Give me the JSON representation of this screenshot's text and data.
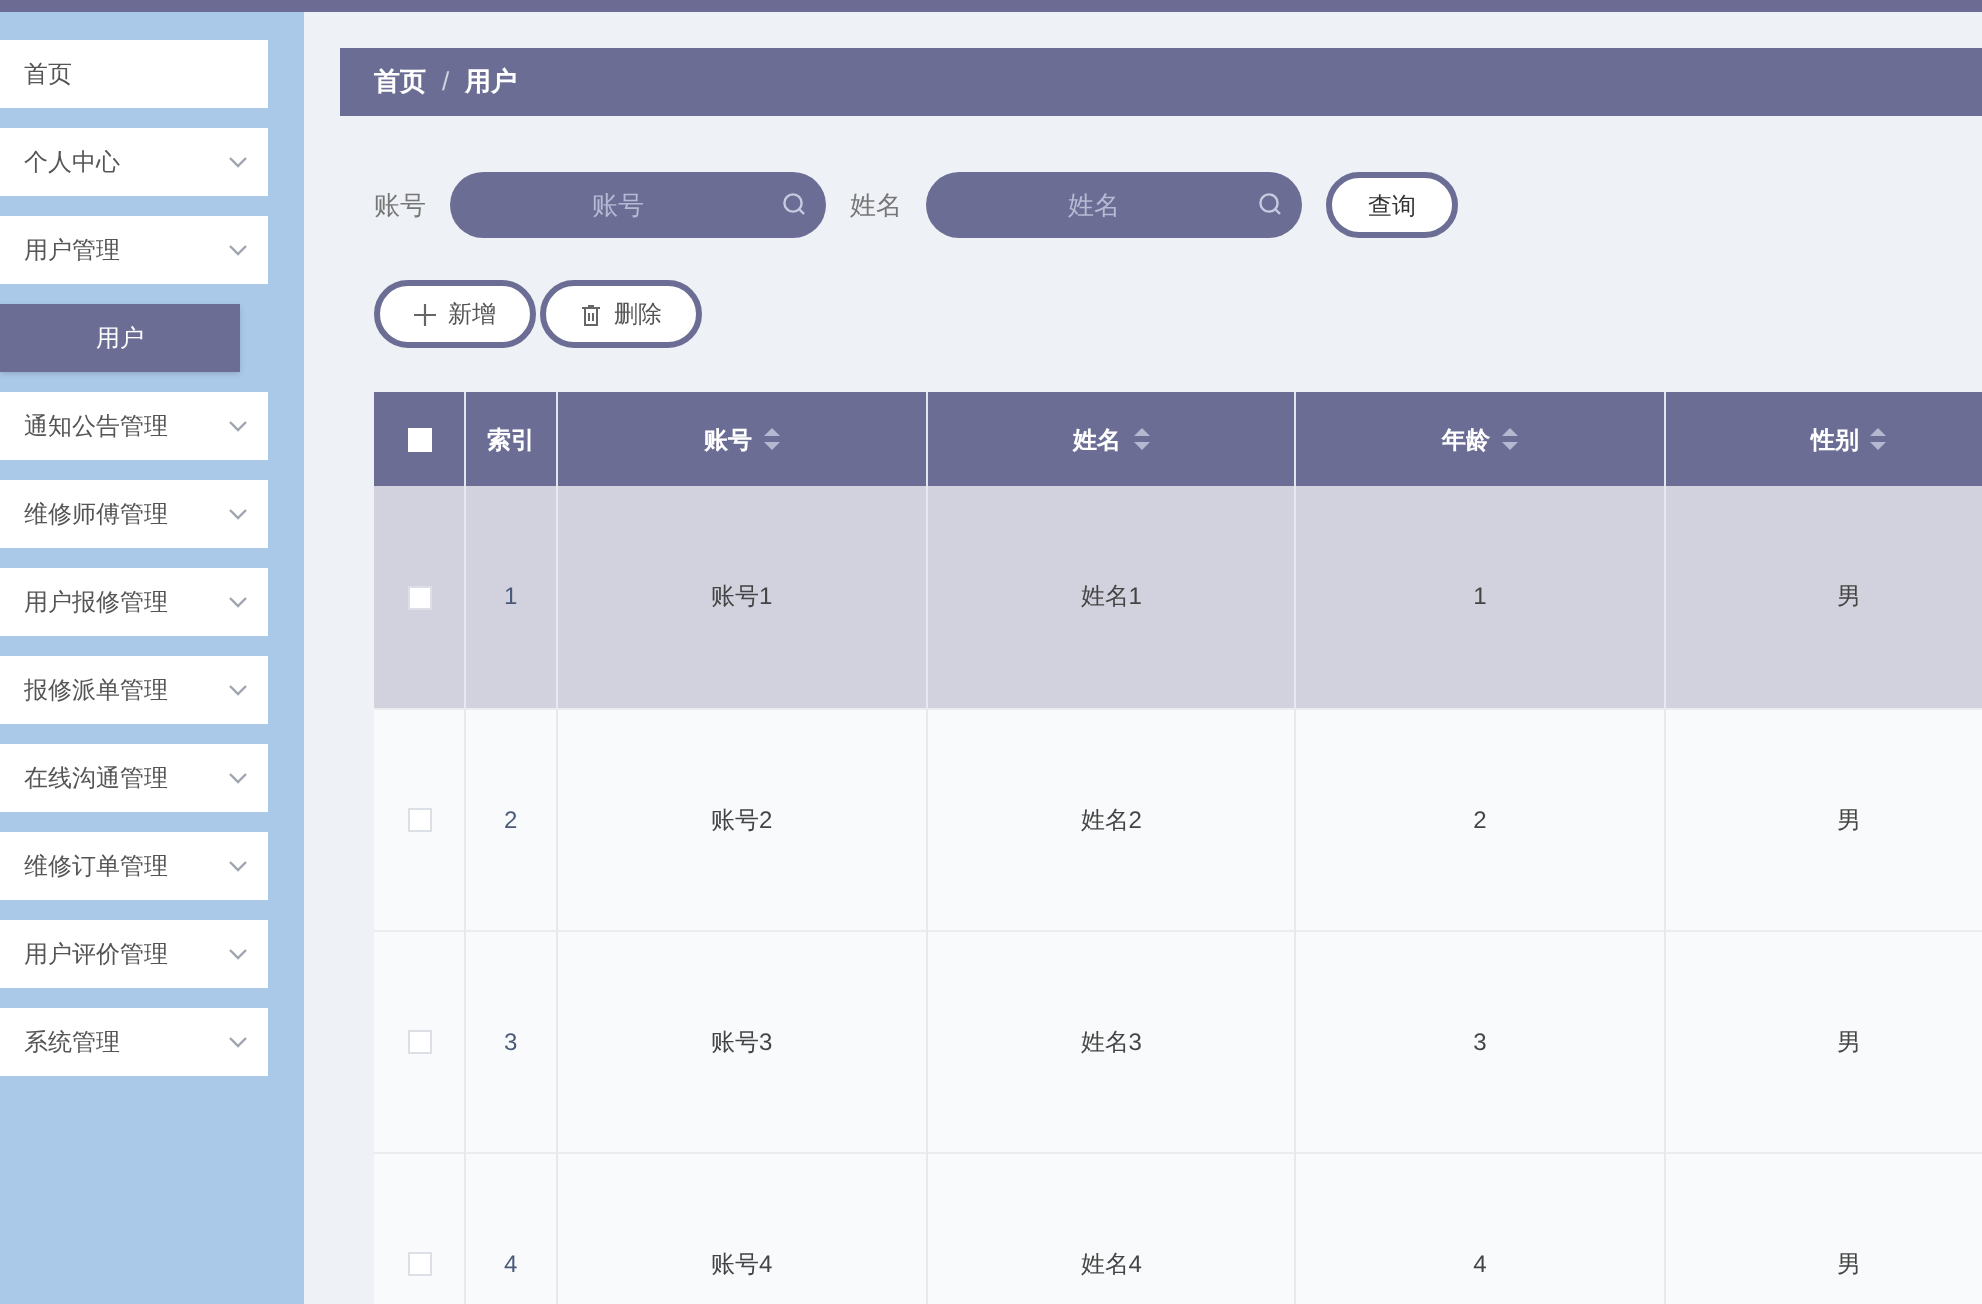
{
  "sidebar": {
    "items": [
      {
        "label": "首页",
        "expandable": false
      },
      {
        "label": "个人中心",
        "expandable": true
      },
      {
        "label": "用户管理",
        "expandable": true,
        "children": [
          {
            "label": "用户",
            "selected": true
          }
        ]
      },
      {
        "label": "通知公告管理",
        "expandable": true
      },
      {
        "label": "维修师傅管理",
        "expandable": true
      },
      {
        "label": "用户报修管理",
        "expandable": true
      },
      {
        "label": "报修派单管理",
        "expandable": true
      },
      {
        "label": "在线沟通管理",
        "expandable": true
      },
      {
        "label": "维修订单管理",
        "expandable": true
      },
      {
        "label": "用户评价管理",
        "expandable": true
      },
      {
        "label": "系统管理",
        "expandable": true
      }
    ]
  },
  "breadcrumb": {
    "items": [
      "首页",
      "用户"
    ],
    "separator": "/"
  },
  "search": {
    "fields": [
      {
        "label": "账号",
        "placeholder": "账号"
      },
      {
        "label": "姓名",
        "placeholder": "姓名"
      }
    ],
    "button": "查询"
  },
  "actions": [
    {
      "kind": "add",
      "label": "新增"
    },
    {
      "kind": "delete",
      "label": "删除"
    }
  ],
  "table": {
    "select_all": {
      "checked": false
    },
    "columns": [
      {
        "label": "索引",
        "sortable": false
      },
      {
        "label": "账号",
        "sortable": true
      },
      {
        "label": "姓名",
        "sortable": true
      },
      {
        "label": "年龄",
        "sortable": true
      },
      {
        "label": "性别",
        "sortable": true
      }
    ],
    "rows": [
      {
        "cells": [
          "1",
          "账号1",
          "姓名1",
          "1",
          "男"
        ],
        "hovered": true,
        "checked": false
      },
      {
        "cells": [
          "2",
          "账号2",
          "姓名2",
          "2",
          "男"
        ],
        "hovered": false,
        "checked": false
      },
      {
        "cells": [
          "3",
          "账号3",
          "姓名3",
          "3",
          "男"
        ],
        "hovered": false,
        "checked": false
      },
      {
        "cells": [
          "4",
          "账号4",
          "姓名4",
          "4",
          "男"
        ],
        "hovered": false,
        "checked": false
      }
    ]
  }
}
